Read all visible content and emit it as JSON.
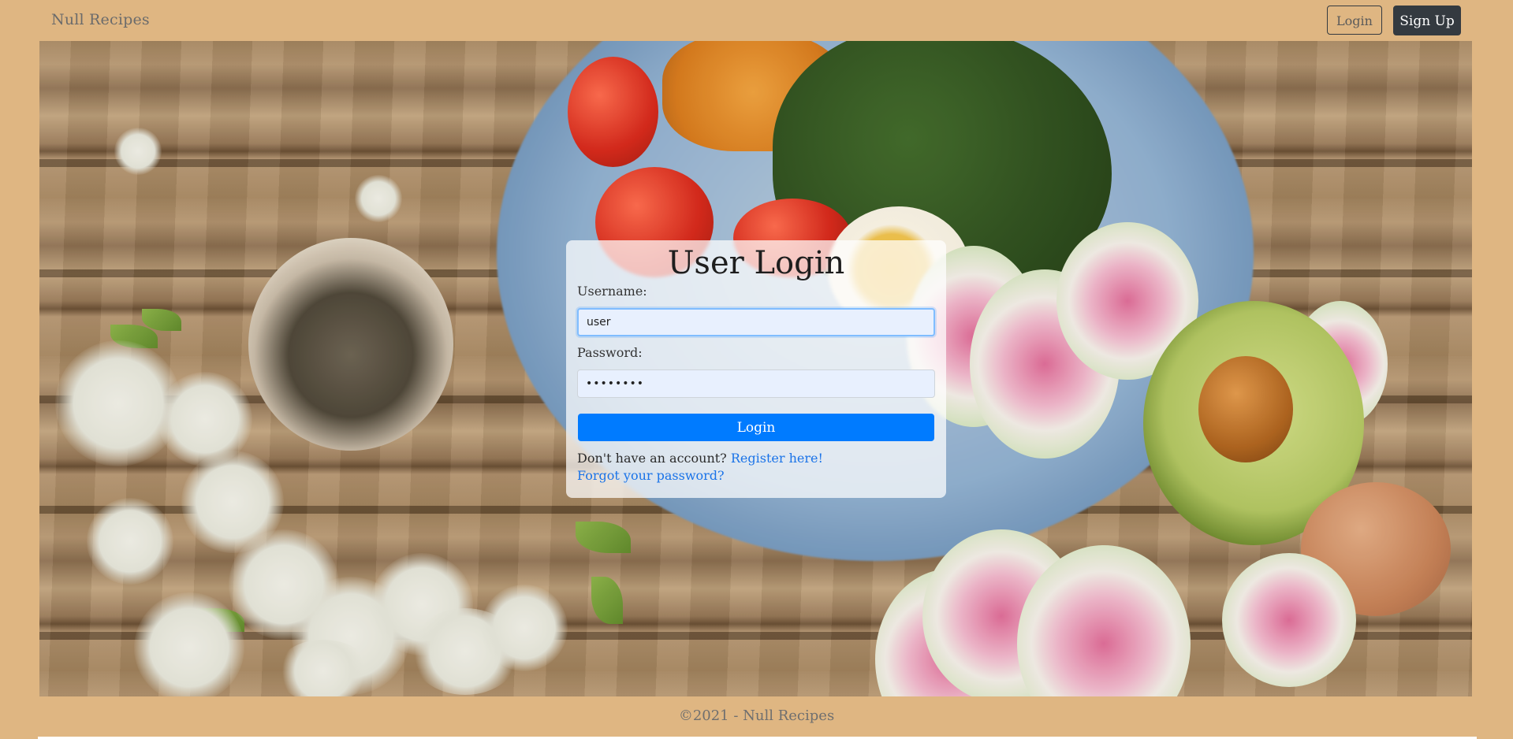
{
  "navbar": {
    "brand": "Null Recipes",
    "login_label": "Login",
    "signup_label": "Sign Up"
  },
  "login_card": {
    "title": "User Login",
    "username_label": "Username:",
    "username_value": "user",
    "password_label": "Password:",
    "password_value": "••••••••",
    "submit_label": "Login",
    "register_prompt": "Don't have an account?",
    "register_link": "Register here!",
    "forgot_link": "Forgot your password?"
  },
  "footer": {
    "text": "©2021 - Null Recipes"
  },
  "colors": {
    "page_background": "#dfb682",
    "primary_button": "#007bff",
    "dark_button": "#343a40",
    "link": "#1a73e8"
  },
  "hero": {
    "image": "food-on-wooden-table-background"
  }
}
